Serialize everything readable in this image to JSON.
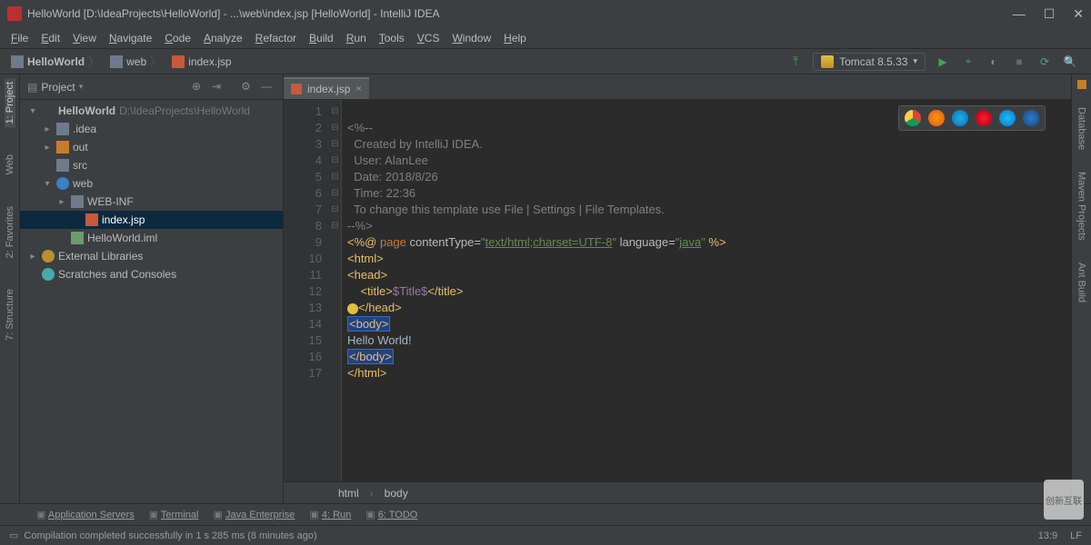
{
  "window": {
    "title": "HelloWorld [D:\\IdeaProjects\\HelloWorld] - ...\\web\\index.jsp [HelloWorld] - IntelliJ IDEA"
  },
  "menu": [
    "File",
    "Edit",
    "View",
    "Navigate",
    "Code",
    "Analyze",
    "Refactor",
    "Build",
    "Run",
    "Tools",
    "VCS",
    "Window",
    "Help"
  ],
  "breadcrumbs": [
    {
      "icon": "project",
      "label": "HelloWorld"
    },
    {
      "icon": "folder",
      "label": "web"
    },
    {
      "icon": "jsp",
      "label": "index.jsp"
    }
  ],
  "run_config": "Tomcat 8.5.33",
  "left_tabs": [
    "1: Project",
    "Web",
    "2: Favorites",
    "7: Structure"
  ],
  "right_tabs": [
    "Database",
    "Maven Projects",
    "Ant Build"
  ],
  "project_panel": {
    "title": "Project"
  },
  "tree": [
    {
      "depth": 0,
      "arrow": "▾",
      "icon": "project",
      "label": "HelloWorld",
      "hint": "D:\\IdeaProjects\\HelloWorld",
      "bold": true
    },
    {
      "depth": 1,
      "arrow": "▸",
      "icon": "folder",
      "label": ".idea"
    },
    {
      "depth": 1,
      "arrow": "▸",
      "icon": "ofolder",
      "label": "out"
    },
    {
      "depth": 1,
      "arrow": "",
      "icon": "folder",
      "label": "src"
    },
    {
      "depth": 1,
      "arrow": "▾",
      "icon": "web",
      "label": "web"
    },
    {
      "depth": 2,
      "arrow": "▸",
      "icon": "folder",
      "label": "WEB-INF"
    },
    {
      "depth": 3,
      "arrow": "",
      "icon": "jsp",
      "label": "index.jsp",
      "selected": true
    },
    {
      "depth": 2,
      "arrow": "",
      "icon": "iml",
      "label": "HelloWorld.iml"
    },
    {
      "depth": 0,
      "arrow": "▸",
      "icon": "lib",
      "label": "External Libraries"
    },
    {
      "depth": 0,
      "arrow": "",
      "icon": "scratch",
      "label": "Scratches and Consoles"
    }
  ],
  "editor_tab": {
    "name": "index.jsp"
  },
  "code_lines": 17,
  "editor": {
    "l1": "<%--",
    "l2": "  Created by IntelliJ IDEA.",
    "l3": "  User: AlanLee",
    "l4": "  Date: 2018/8/26",
    "l5": "  Time: 22:36",
    "l6": "  To change this template use File | Settings | File Templates.",
    "l7": "--%>",
    "l8a": "<%@ ",
    "l8b": "page",
    "l8c": " contentType=",
    "l8d": "\"",
    "l8e": "text/html;charset=UTF-8",
    "l8f": "\"",
    "l8g": " language=",
    "l8h": "\"",
    "l8i": "java",
    "l8j": "\"",
    "l8k": " %>",
    "l9o": "<",
    "l9t": "html",
    "l9c": ">",
    "l10o": "<",
    "l10t": "head",
    "l10c": ">",
    "l11o": "    <",
    "l11t": "title",
    "l11c": ">",
    "l11v": "$Title$",
    "l11co": "</",
    "l11cc": ">",
    "l12o": "</",
    "l12t": "head",
    "l12c": ">",
    "l13o": "<",
    "l13t": "body",
    "l13c": ">",
    "l14": "Hello World!",
    "l15o": "</",
    "l15t": "body",
    "l15c": ">",
    "l16o": "</",
    "l16t": "html",
    "l16c": ">"
  },
  "crumb_path": [
    "html",
    "body"
  ],
  "bottom_tools": [
    "Application Servers",
    "Terminal",
    "Java Enterprise",
    "4: Run",
    "6: TODO"
  ],
  "status": {
    "msg": "Compilation completed successfully in 1 s 285 ms (8 minutes ago)",
    "pos": "13:9",
    "le": "LF"
  },
  "watermark": "创新互联"
}
